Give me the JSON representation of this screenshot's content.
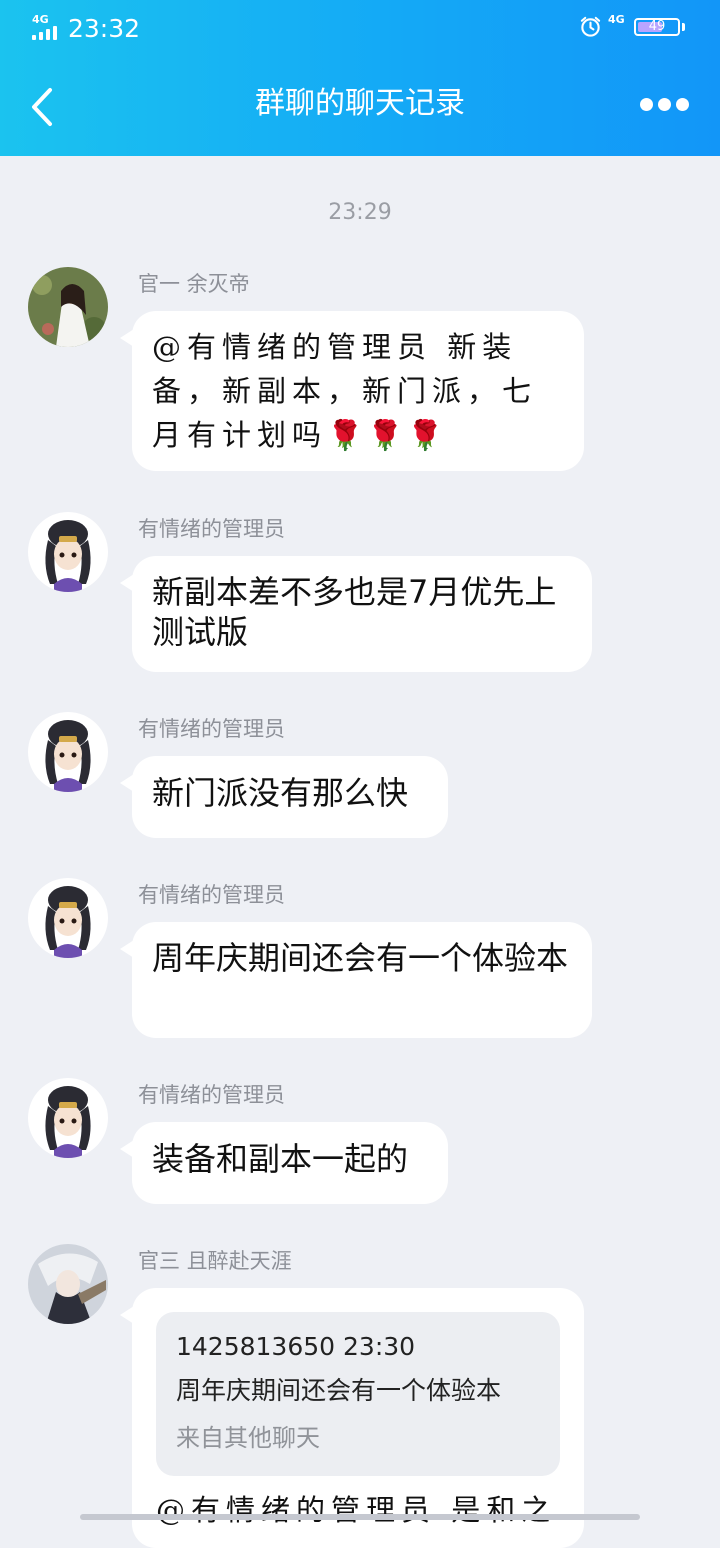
{
  "status_bar": {
    "time": "23:32",
    "signal_label": "4G",
    "network_label": "4G",
    "battery": "49"
  },
  "header": {
    "title": "群聊的聊天记录"
  },
  "time_separator": "23:29",
  "messages": [
    {
      "sender": "官一  余灭帝",
      "text": "@有情绪的管理员 新装备，新副本，新门派，七月有计划吗",
      "emoji": "🌹🌹🌹"
    },
    {
      "sender": "有情绪的管理员",
      "text": "新副本差不多也是7月优先上测试版"
    },
    {
      "sender": "有情绪的管理员",
      "text": "新门派没有那么快"
    },
    {
      "sender": "有情绪的管理员",
      "text": "周年庆期间还会有一个体验本"
    },
    {
      "sender": "有情绪的管理员",
      "text": "装备和副本一起的"
    },
    {
      "sender": "官三 且醉赴天涯",
      "quote": {
        "meta": "1425813650 23:30",
        "text": "周年庆期间还会有一个体验本",
        "source": "来自其他聊天"
      },
      "text": "@有情绪的管理员 是和之"
    }
  ]
}
